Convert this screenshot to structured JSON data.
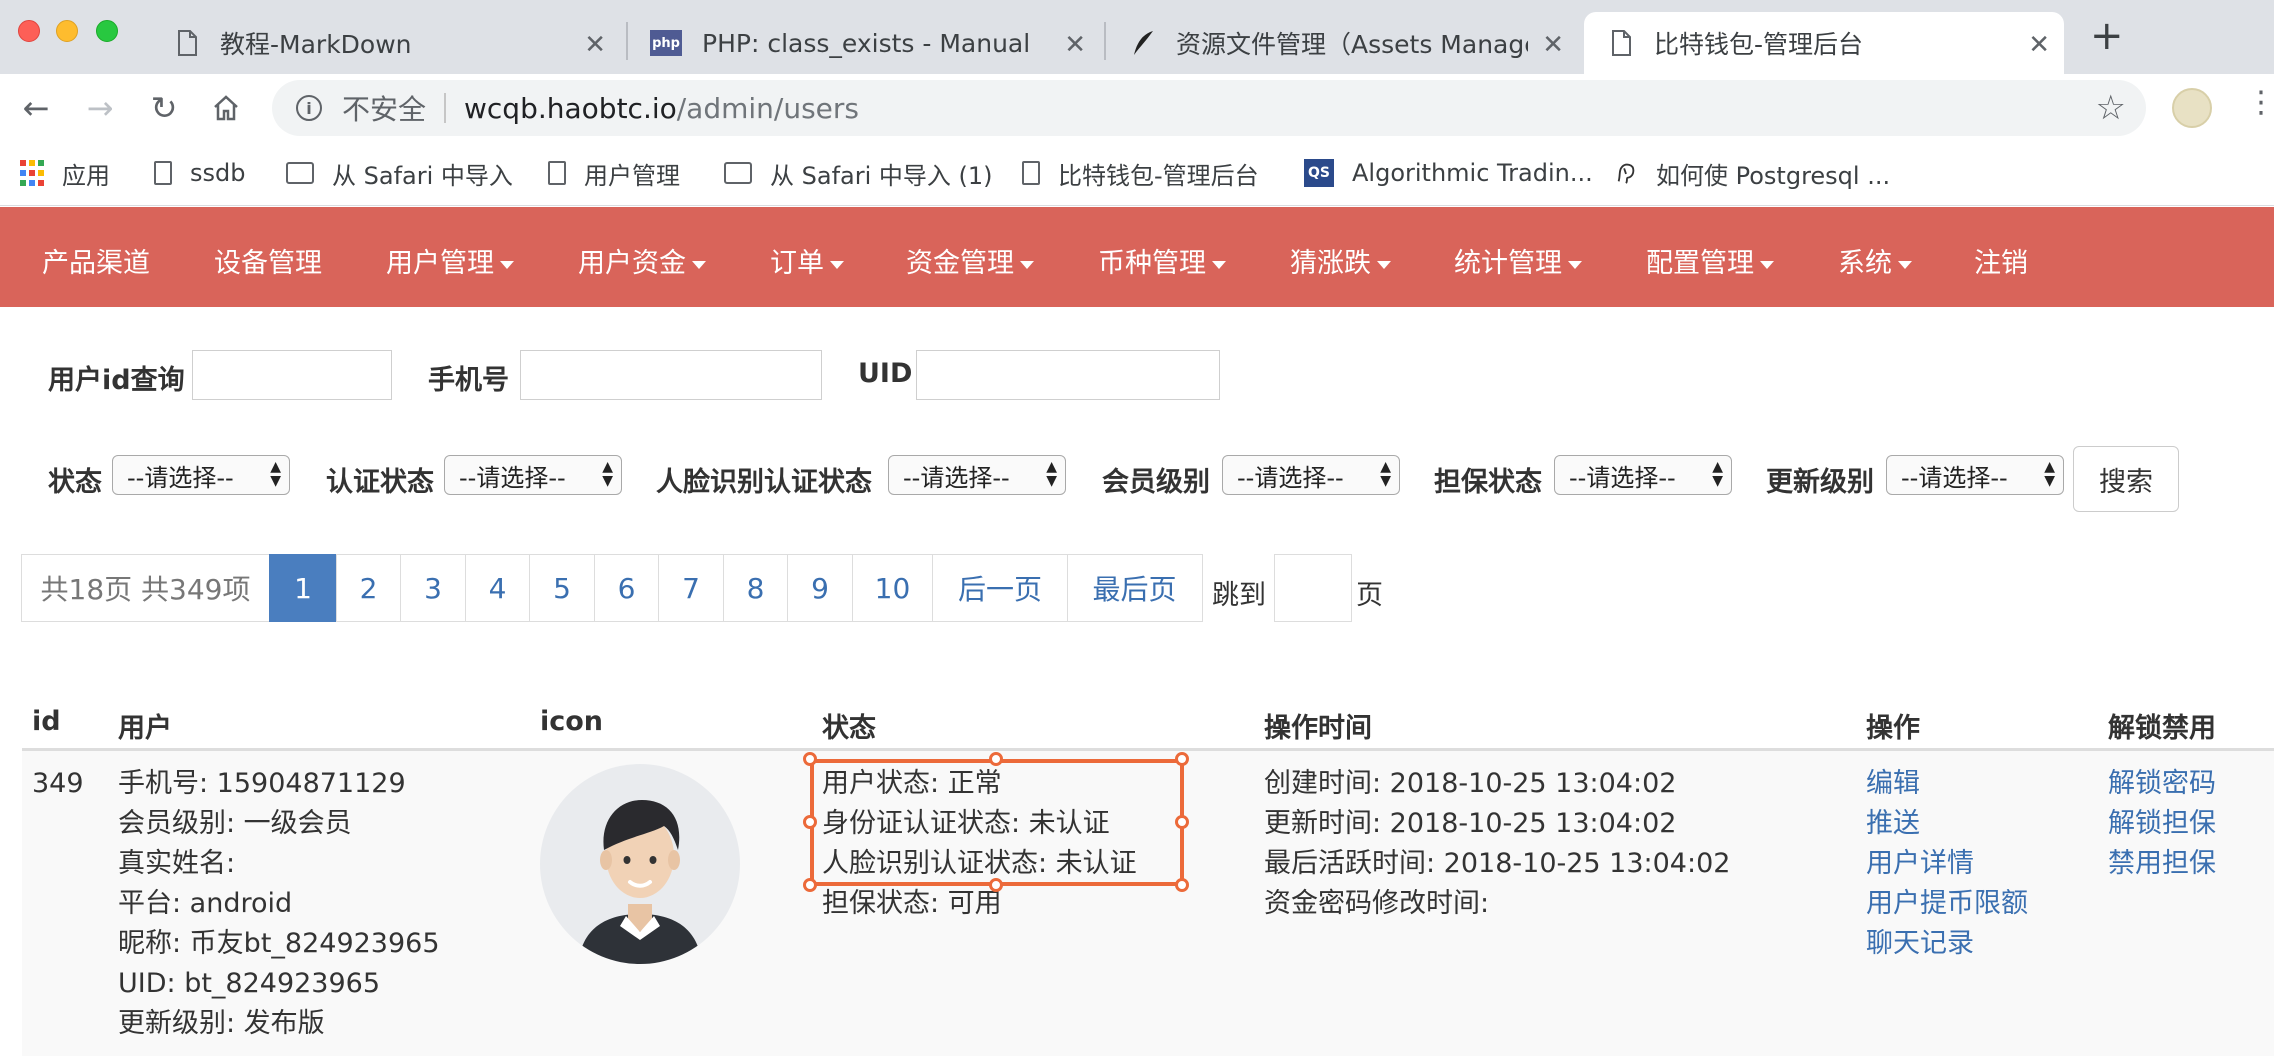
{
  "browser": {
    "tabs": [
      {
        "title": "教程-MarkDown",
        "icon": "document-icon"
      },
      {
        "title": "PHP: class_exists - Manual",
        "icon": "php-icon"
      },
      {
        "title": "资源文件管理（Assets Manager",
        "icon": "feather-icon"
      },
      {
        "title": "比特钱包-管理后台",
        "icon": "document-icon",
        "active": true
      }
    ],
    "address": {
      "security_label": "不安全",
      "host": "wcqb.haobtc.io",
      "path": "/admin/users"
    },
    "bookmarks": [
      {
        "label": "应用",
        "icon": "apps-grid-icon"
      },
      {
        "label": "ssdb",
        "icon": "document-icon"
      },
      {
        "label": "从 Safari 中导入",
        "icon": "folder-icon"
      },
      {
        "label": "用户管理",
        "icon": "document-icon"
      },
      {
        "label": "从 Safari 中导入 (1)",
        "icon": "folder-icon"
      },
      {
        "label": "比特钱包-管理后台",
        "icon": "document-icon"
      },
      {
        "label": "Algorithmic Tradin...",
        "icon": "qs-icon"
      },
      {
        "label": "如何使 Postgresql ...",
        "icon": "elephant-icon"
      }
    ]
  },
  "nav": {
    "brand_color": "#d9645a",
    "items": [
      {
        "label": "产品渠道",
        "dropdown": false
      },
      {
        "label": "设备管理",
        "dropdown": false
      },
      {
        "label": "用户管理",
        "dropdown": true
      },
      {
        "label": "用户资金",
        "dropdown": true
      },
      {
        "label": "订单",
        "dropdown": true
      },
      {
        "label": "资金管理",
        "dropdown": true
      },
      {
        "label": "币种管理",
        "dropdown": true
      },
      {
        "label": "猜涨跌",
        "dropdown": true
      },
      {
        "label": "统计管理",
        "dropdown": true
      },
      {
        "label": "配置管理",
        "dropdown": true
      },
      {
        "label": "系统",
        "dropdown": true
      },
      {
        "label": "注销",
        "dropdown": false
      }
    ]
  },
  "filters": {
    "user_id_label": "用户id查询",
    "phone_label": "手机号",
    "uid_label": "UID",
    "user_id_value": "",
    "phone_value": "",
    "uid_value": "",
    "selects": [
      {
        "label": "状态",
        "value": "--请选择--"
      },
      {
        "label": "认证状态",
        "value": "--请选择--"
      },
      {
        "label": "人脸识别认证状态",
        "value": "--请选择--"
      },
      {
        "label": "会员级别",
        "value": "--请选择--"
      },
      {
        "label": "担保状态",
        "value": "--请选择--"
      },
      {
        "label": "更新级别",
        "value": "--请选择--"
      }
    ],
    "search_button": "搜索"
  },
  "pagination": {
    "summary": "共18页 共349项",
    "current_page": "1",
    "pages": [
      "2",
      "3",
      "4",
      "5",
      "6",
      "7",
      "8",
      "9",
      "10"
    ],
    "next_label": "后一页",
    "last_label": "最后页",
    "goto_prefix": "跳到",
    "goto_suffix": "页",
    "goto_value": ""
  },
  "table": {
    "headers": {
      "id": "id",
      "user": "用户",
      "icon": "icon",
      "status": "状态",
      "time": "操作时间",
      "actions": "操作",
      "unlock": "解锁禁用"
    },
    "row": {
      "id": "349",
      "user_lines": [
        "手机号: 15904871129",
        "会员级别: 一级会员",
        "真实姓名:",
        "平台: android",
        "昵称: 币友bt_824923965",
        "UID: bt_824923965",
        "更新级别: 发布版"
      ],
      "status_lines": [
        "用户状态: 正常",
        "身份证认证状态: 未认证",
        "人脸识别认证状态: 未认证",
        "担保状态: 可用"
      ],
      "time_lines": [
        "创建时间: 2018-10-25 13:04:02",
        "更新时间: 2018-10-25 13:04:02",
        "最后活跃时间: 2018-10-25 13:04:02",
        "资金密码修改时间:"
      ],
      "actions": [
        "编辑",
        "推送",
        "用户详情",
        "用户提币限额",
        "聊天记录"
      ],
      "unlock_actions": [
        "解锁密码",
        "解锁担保",
        "禁用担保"
      ]
    }
  }
}
